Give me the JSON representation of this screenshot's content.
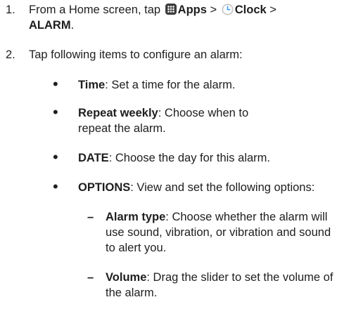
{
  "step1": {
    "number": "1.",
    "text_before": "From a Home screen, tap",
    "apps_label": "Apps",
    "sep1": ">",
    "clock_label": "Clock",
    "sep2": ">",
    "alarm_label": "ALARM",
    "end": ".",
    "icons": [
      "apps-grid-icon",
      "clock-icon"
    ]
  },
  "step2": {
    "number": "2.",
    "text": "Tap following items to configure an alarm:"
  },
  "bullets": [
    {
      "dot": "•",
      "term": "Time",
      "desc": ": Set a time for the alarm."
    },
    {
      "dot": "•",
      "term": "Repeat weekly",
      "desc": ": Choose when to repeat the alarm."
    },
    {
      "dot": "•",
      "term": "DATE",
      "desc": ": Choose the day for this alarm."
    },
    {
      "dot": "•",
      "term": "OPTIONS",
      "desc": ": View and set the following options:"
    }
  ],
  "sub_items": [
    {
      "dash": "–",
      "term": "Alarm type",
      "desc": ": Choose whether the alarm will use sound, vibration, or vibration and sound to alert you."
    },
    {
      "dash": "–",
      "term": "Volume",
      "desc": ": Drag the slider to set the volume of the alarm."
    }
  ]
}
